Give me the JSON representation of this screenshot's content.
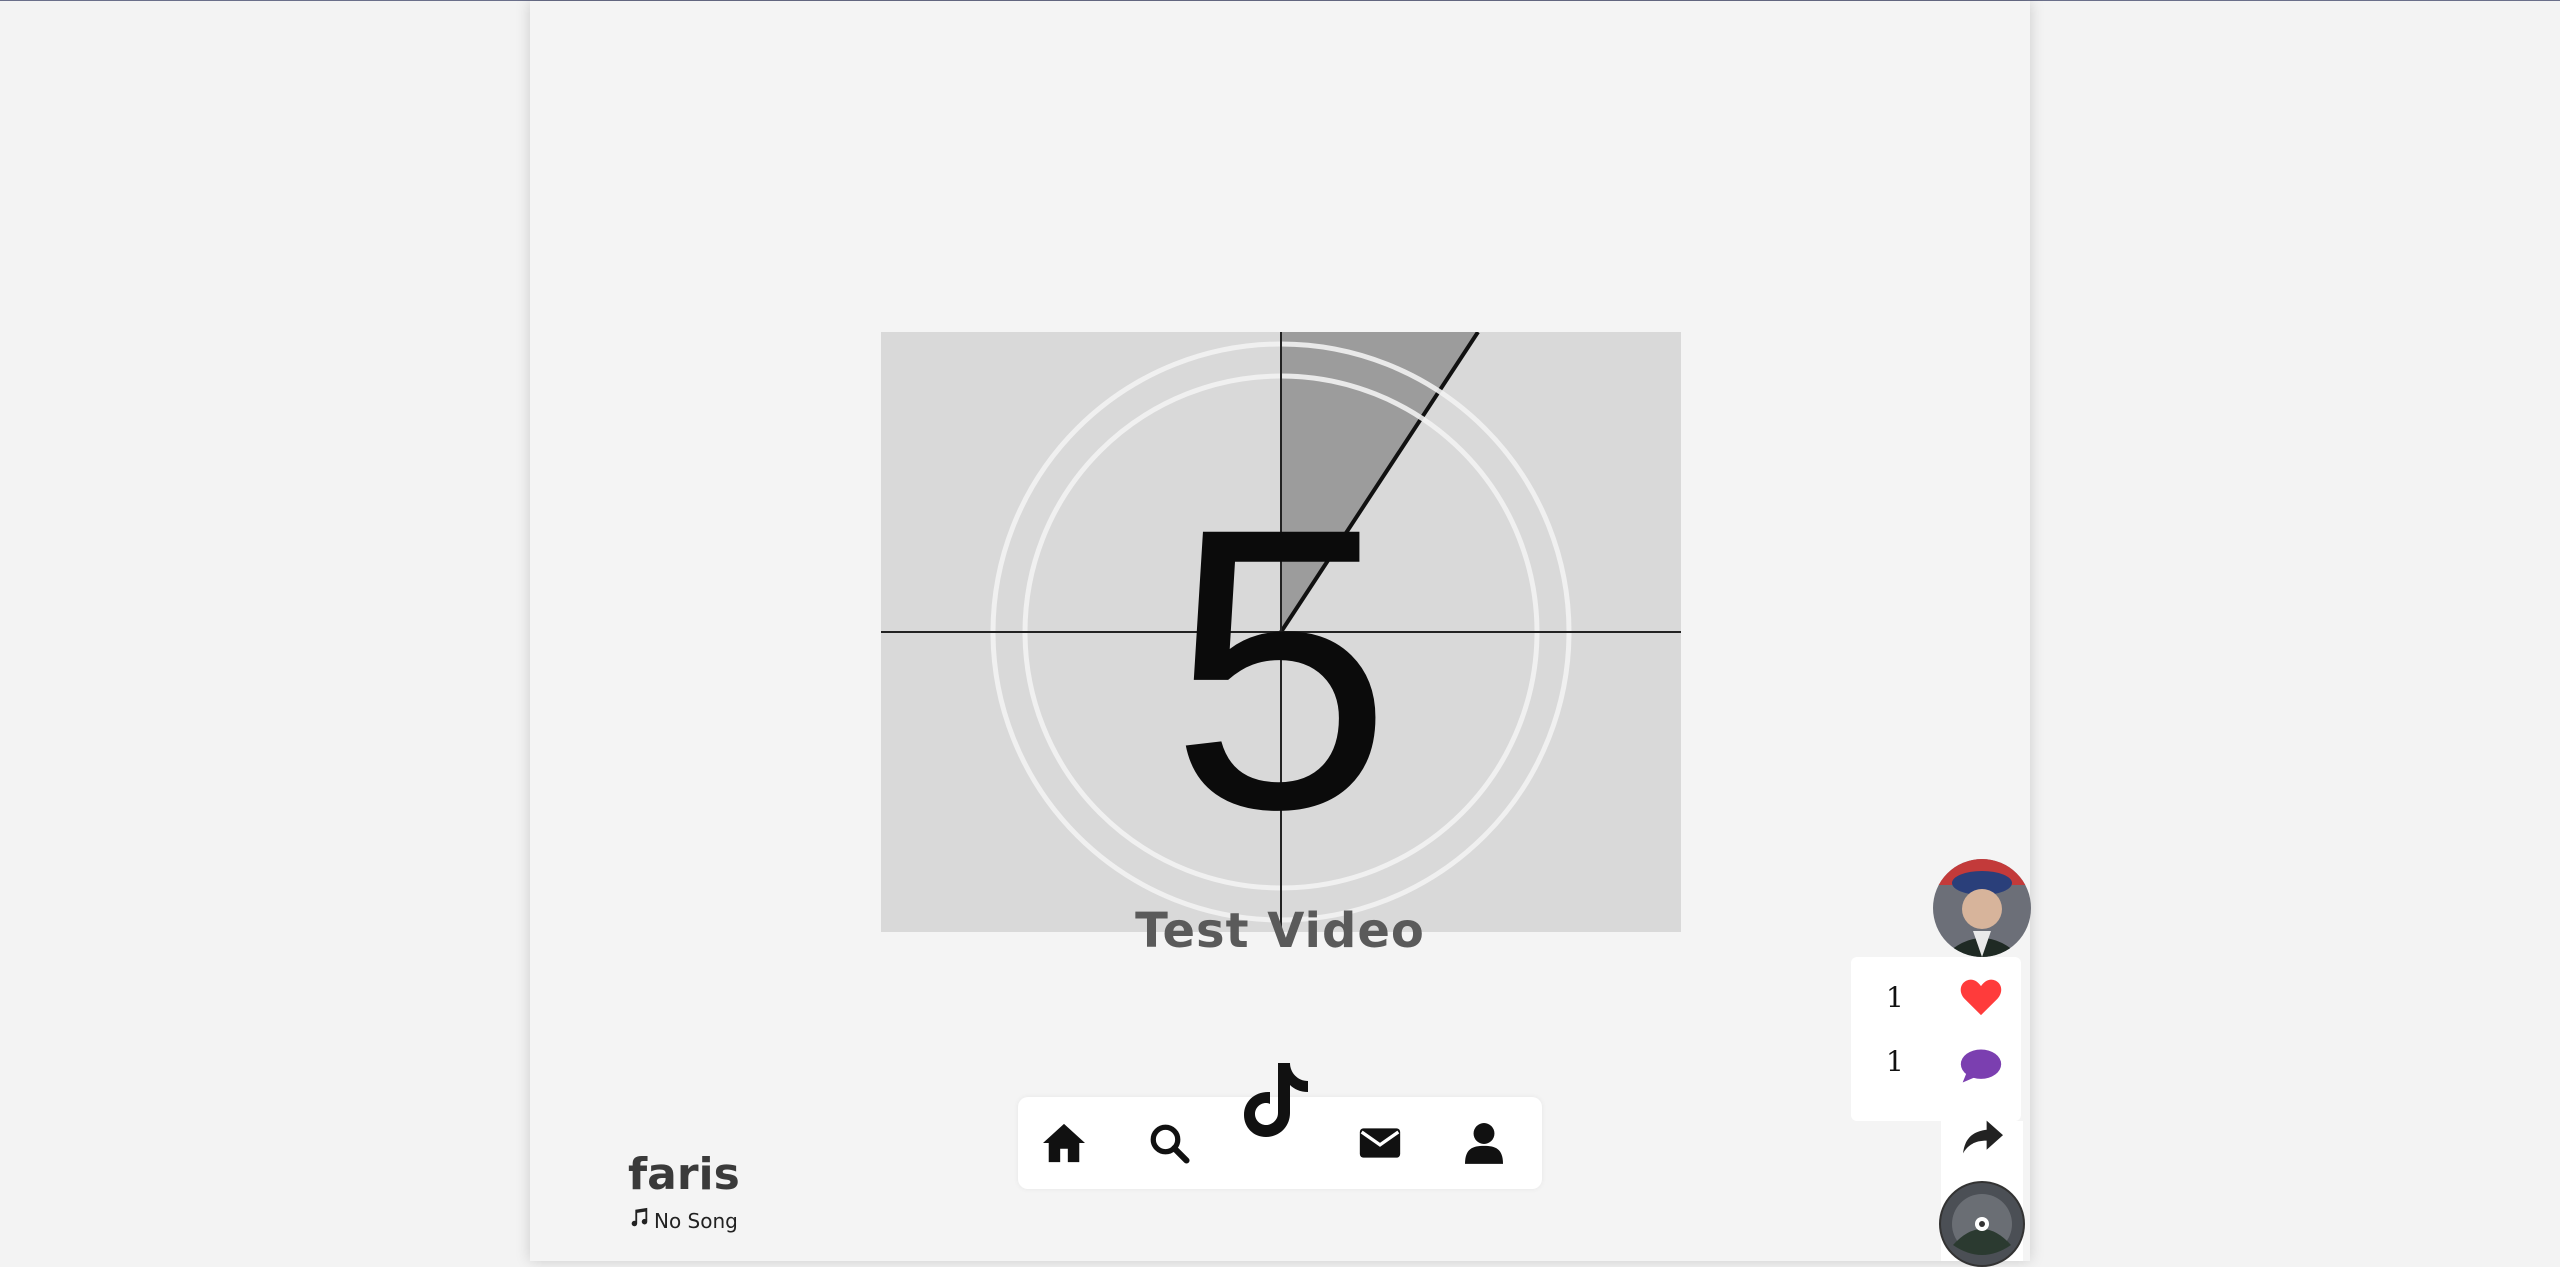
{
  "video": {
    "countdown_number": "5",
    "title": "Test Video"
  },
  "user": {
    "username": "faris",
    "song": "No Song"
  },
  "actions": {
    "likes_count": "1",
    "comments_count": "1"
  },
  "nav": {
    "items": [
      "home-icon",
      "search-icon",
      "tiktok-logo-icon",
      "mail-icon",
      "profile-icon"
    ]
  },
  "colors": {
    "background": "#f3f3f3",
    "heart": "#ff3b3b",
    "comment": "#7b3fb0",
    "nav_icons": "#111111",
    "title": "#5a5a5a"
  }
}
